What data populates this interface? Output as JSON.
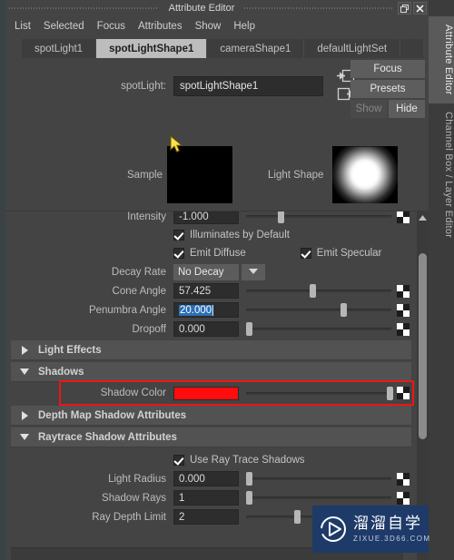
{
  "window": {
    "title": "Attribute Editor",
    "restore_icon": "restore-icon",
    "close_icon": "close-icon"
  },
  "menubar": {
    "items": [
      {
        "label": "List"
      },
      {
        "label": "Selected"
      },
      {
        "label": "Focus"
      },
      {
        "label": "Attributes"
      },
      {
        "label": "Show"
      },
      {
        "label": "Help"
      }
    ]
  },
  "node_tabs": [
    {
      "label": "spotLight1",
      "active": false
    },
    {
      "label": "spotLightShape1",
      "active": true
    },
    {
      "label": "cameraShape1",
      "active": false
    },
    {
      "label": "defaultLightSet",
      "active": false
    }
  ],
  "header": {
    "node_type_label": "spotLight:",
    "node_name_value": "spotLightShape1",
    "input_icon": "arrow-into-box-icon",
    "output_icon": "arrow-out-of-box-icon",
    "focus_button": "Focus",
    "presets_button": "Presets",
    "show_button": "Show",
    "hide_button": "Hide"
  },
  "previews": {
    "sample_label": "Sample",
    "light_shape_label": "Light Shape"
  },
  "attributes": {
    "intensity": {
      "label": "Intensity",
      "value": "-1.000",
      "knob_pct": 22
    },
    "illuminates_by_default": {
      "label": "Illuminates by Default",
      "checked": true
    },
    "emit_diffuse": {
      "label": "Emit Diffuse",
      "checked": true
    },
    "emit_specular": {
      "label": "Emit Specular",
      "checked": true
    },
    "decay_rate": {
      "label": "Decay Rate",
      "value": "No Decay"
    },
    "cone_angle": {
      "label": "Cone Angle",
      "value": "57.425",
      "knob_pct": 44
    },
    "penumbra_angle": {
      "label": "Penumbra Angle",
      "value": "20.000",
      "knob_pct": 65,
      "selected": true
    },
    "dropoff": {
      "label": "Dropoff",
      "value": "0.000",
      "knob_pct": 1
    },
    "shadow_color": {
      "label": "Shadow Color",
      "color": "#ff0c0c",
      "knob_pct": 97
    },
    "use_ray_trace_shadows": {
      "label": "Use Ray Trace Shadows",
      "checked": true
    },
    "light_radius": {
      "label": "Light Radius",
      "value": "0.000",
      "knob_pct": 1
    },
    "shadow_rays": {
      "label": "Shadow Rays",
      "value": "1",
      "knob_pct": 1
    },
    "ray_depth_limit": {
      "label": "Ray Depth Limit",
      "value": "2",
      "knob_pct": 33
    }
  },
  "sections": {
    "light_effects": {
      "label": "Light Effects",
      "expanded": false
    },
    "shadows": {
      "label": "Shadows",
      "expanded": true
    },
    "depth_map_shadow": {
      "label": "Depth Map Shadow Attributes",
      "expanded": false
    },
    "raytrace_shadow": {
      "label": "Raytrace Shadow Attributes",
      "expanded": true
    }
  },
  "side_tabs": [
    {
      "label": "Attribute Editor",
      "active": true
    },
    {
      "label": "Channel Box / Layer Editor",
      "active": false
    }
  ],
  "watermark": {
    "cn_text": "溜溜自学",
    "en_text": "ZIXUE.3D66.COM",
    "logo_icon": "play-button-logo-icon",
    "background": "#1e3a68"
  },
  "colors": {
    "panel_bg": "#444444",
    "section_bg": "#525252",
    "field_bg": "#2d2d2d",
    "accent_red": "#f01414",
    "selection_blue": "#2a6fb5"
  }
}
